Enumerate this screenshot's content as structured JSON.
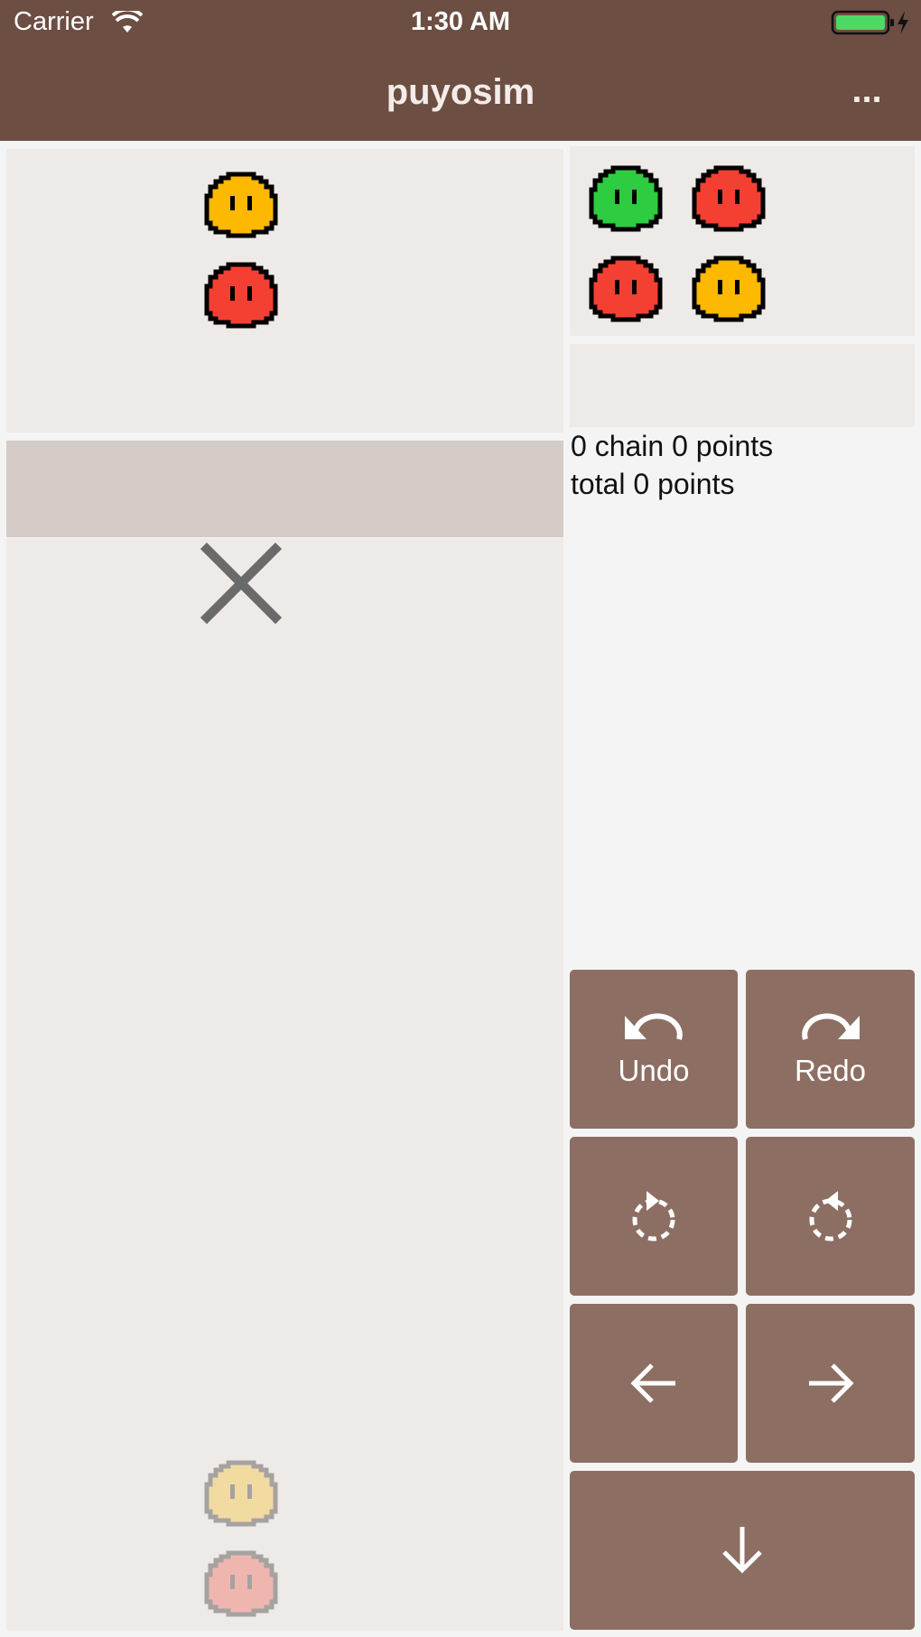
{
  "status_bar": {
    "carrier": "Carrier",
    "time": "1:30 AM"
  },
  "nav": {
    "title": "puyosim",
    "more_label": "..."
  },
  "current_pair": {
    "top": "yellow",
    "bottom": "red"
  },
  "next_pairs": [
    {
      "top": "green",
      "bottom": "red"
    },
    {
      "top": "red",
      "bottom": "yellow"
    }
  ],
  "ghost_pair": {
    "top": "yellow",
    "bottom": "red"
  },
  "score": {
    "chain_text": "0 chain 0 points",
    "total_text": "total 0 points"
  },
  "buttons": {
    "undo": "Undo",
    "redo": "Redo"
  },
  "icons": {
    "undo": "undo-arrow-icon",
    "redo": "redo-arrow-icon",
    "rotate_left": "rotate-counterclockwise-icon",
    "rotate_right": "rotate-clockwise-icon",
    "left": "arrow-left-icon",
    "right": "arrow-right-icon",
    "drop": "arrow-down-icon",
    "death": "x-mark-icon",
    "wifi": "wifi-icon",
    "battery": "battery-charging-icon"
  },
  "colors": {
    "bar": "#6d4e42",
    "button": "#8c6e62",
    "board": "#eeeae8",
    "drop_zone": "#d5cbc7",
    "yellow": "#fdb900",
    "red": "#f44033",
    "green": "#2ecc40"
  }
}
